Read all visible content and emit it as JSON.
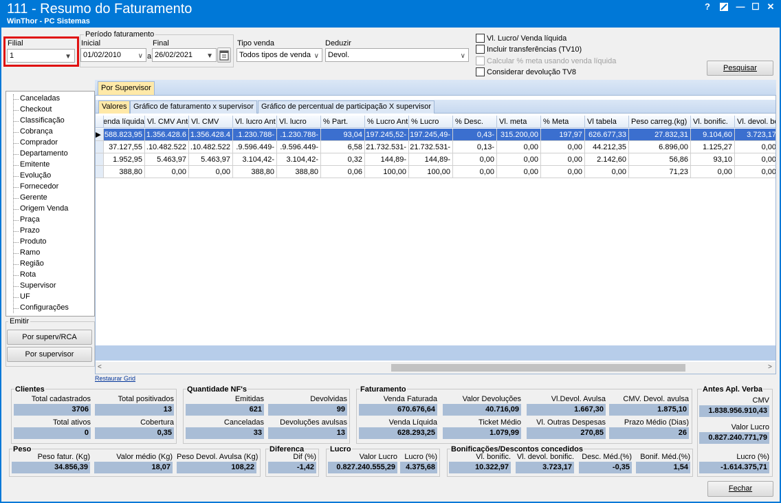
{
  "window": {
    "title": "111 - Resumo do Faturamento",
    "subtitle": "WinThor - PC Sistemas",
    "help": "?",
    "min": "—",
    "max": "☐",
    "close": "✕"
  },
  "filters": {
    "filial": {
      "label": "Filial",
      "value": "1"
    },
    "periodo": {
      "label": "Período faturamento",
      "inicial_label": "Inicial",
      "inicial": "01/02/2010",
      "sep": "a",
      "final_label": "Final",
      "final": "26/02/2021"
    },
    "tipo_venda": {
      "label": "Tipo venda",
      "value": "Todos tipos de venda"
    },
    "deduzir": {
      "label": "Deduzir",
      "value": "Devol."
    },
    "options": [
      {
        "label": "Vl. Lucro/ Venda líquida",
        "checked": false,
        "enabled": true
      },
      {
        "label": "Incluir transferências  (TV10)",
        "checked": false,
        "enabled": true
      },
      {
        "label": "Calcular % meta usando venda líquida",
        "checked": false,
        "enabled": false
      },
      {
        "label": "Considerar devolução TV8",
        "checked": false,
        "enabled": true
      }
    ],
    "search_button": "Pesquisar"
  },
  "tree": {
    "items": [
      "Canceladas",
      "Checkout",
      "Classificação",
      "Cobrança",
      "Comprador",
      "Departamento",
      "Emitente",
      "Evolução",
      "Fornecedor",
      "Gerente",
      "Origem Venda",
      "Praça",
      "Prazo",
      "Produto",
      "Ramo",
      "Região",
      "Rota",
      "Supervisor",
      "UF",
      "Configurações"
    ]
  },
  "emitir": {
    "label": "Emitir",
    "btn1": "Por superv/RCA",
    "btn2": "Por supervisor"
  },
  "outer_tab": "Por Supervisor",
  "inner_tabs": [
    "Valores",
    "Gráfico de faturamento x supervisor",
    "Gráfico de percentual de participação X supervisor"
  ],
  "grid": {
    "columns": [
      "Venda líquida",
      "Vl. CMV Ante",
      "Vl. CMV",
      "Vl. lucro Ant",
      "Vl. lucro",
      "% Part.",
      "% Lucro Ant",
      "% Lucro",
      "% Desc.",
      "Vl. meta",
      "% Meta",
      "Vl tabela",
      "Peso carreg.(kg)",
      "Vl. bonific.",
      "Vl. devol. bo"
    ],
    "rows": [
      [
        "588.823,95",
        "1.356.428.6",
        "1.356.428.4",
        "-1.230.788.",
        "-1.230.788.",
        "93,04",
        "-197.245,52",
        "-197.245,49",
        "-0,43",
        "315.200,00",
        "197,97",
        "626.677,33",
        "27.832,31",
        "9.104,60",
        "3.723,17"
      ],
      [
        "37.127,55",
        "10.482.522.",
        "10.482.522.",
        "-9.596.449.",
        "-9.596.449.",
        "6,58",
        "-21.732.531",
        "-21.732.531",
        "-0,13",
        "0,00",
        "0,00",
        "44.212,35",
        "6.896,00",
        "1.125,27",
        "0,00"
      ],
      [
        "1.952,95",
        "5.463,97",
        "5.463,97",
        "-3.104,42",
        "-3.104,42",
        "0,32",
        "-144,89",
        "-144,89",
        "0,00",
        "0,00",
        "0,00",
        "2.142,60",
        "56,86",
        "93,10",
        "0,00"
      ],
      [
        "388,80",
        "0,00",
        "0,00",
        "388,80",
        "388,80",
        "0,06",
        "100,00",
        "100,00",
        "0,00",
        "0,00",
        "0,00",
        "0,00",
        "71,23",
        "0,00",
        "0,00"
      ]
    ],
    "restore": "Restaurar Grid"
  },
  "clientes": {
    "title": "Clientes",
    "total_cadastrados": {
      "label": "Total cadastrados",
      "value": "3706"
    },
    "total_positivados": {
      "label": "Total positivados",
      "value": "13"
    },
    "total_ativos": {
      "label": "Total ativos",
      "value": "0"
    },
    "cobertura": {
      "label": "Cobertura",
      "value": "0,35"
    }
  },
  "nfs": {
    "title": "Quantidade NF's",
    "emitidas": {
      "label": "Emitidas",
      "value": "621"
    },
    "devolvidas": {
      "label": "Devolvidas",
      "value": "99"
    },
    "canceladas": {
      "label": "Canceladas",
      "value": "33"
    },
    "dev_avulsas": {
      "label": "Devoluções avulsas",
      "value": "13"
    }
  },
  "faturamento": {
    "title": "Faturamento",
    "venda_faturada": {
      "label": "Venda Faturada",
      "value": "670.676,64"
    },
    "valor_devolucoes": {
      "label": "Valor Devoluções",
      "value": "40.716,09"
    },
    "vl_devol_avulsa": {
      "label": "Vl.Devol. Avulsa",
      "value": "1.667,30"
    },
    "cmv_devol_avulsa": {
      "label": "CMV. Devol. avulsa",
      "value": "1.875,10"
    },
    "venda_liquida": {
      "label": "Venda Líquida",
      "value": "628.293,25"
    },
    "ticket_medio": {
      "label": "Ticket Médio",
      "value": "1.079,99"
    },
    "vl_outras": {
      "label": "Vl. Outras Despesas",
      "value": "270,85"
    },
    "prazo_medio": {
      "label": "Prazo Médio (Dias)",
      "value": "26"
    }
  },
  "verba": {
    "title": "Antes Apl. Verba",
    "cmv": {
      "label": "CMV",
      "value": "1.838.956.910,43"
    },
    "valor_lucro": {
      "label": "Valor Lucro",
      "value": "0.827.240.771,79"
    },
    "lucro_pct": {
      "label": "Lucro (%)",
      "value": "-1.614.375,71"
    }
  },
  "peso": {
    "title": "Peso",
    "fatur": {
      "label": "Peso fatur. (Kg)",
      "value": "34.856,39"
    },
    "medio": {
      "label": "Valor médio (Kg)",
      "value": "18,07"
    },
    "devol": {
      "label": "Peso Devol. Avulsa (Kg)",
      "value": "108,22"
    }
  },
  "diferenca": {
    "title": "Diferenca",
    "dif": {
      "label": "Dif (%)",
      "value": "-1,42"
    }
  },
  "lucro": {
    "title": "Lucro",
    "valor": {
      "label": "Valor Lucro",
      "value": "0.827.240.555,29"
    },
    "pct": {
      "label": "Lucro (%)",
      "value": "4.375,68"
    }
  },
  "bonif": {
    "title": "Bonificações/Descontos concedidos",
    "vl_bonif": {
      "label": "Vl. bonific.",
      "value": "10.322,97"
    },
    "vl_devol_bonif": {
      "label": "Vl. devol. bonific.",
      "value": "3.723,17"
    },
    "desc_med": {
      "label": "Desc. Méd.(%)",
      "value": "-0,35"
    },
    "bonif_med": {
      "label": "Bonif. Méd.(%)",
      "value": "1,54"
    }
  },
  "fechar": "Fechar",
  "colors": {
    "titlebar": "#0078d7",
    "highlight": "#e01010",
    "selection": "#3b6fcf",
    "value_box": "#a9bdd6"
  }
}
